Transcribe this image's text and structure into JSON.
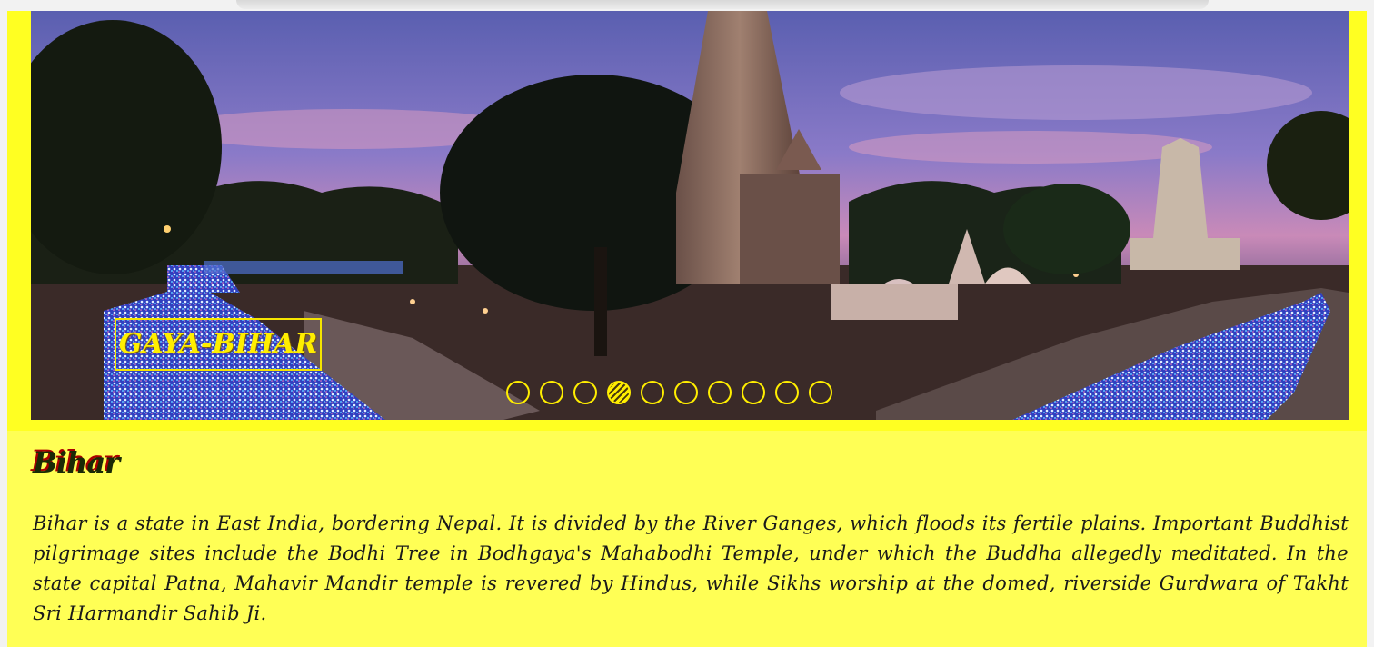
{
  "slider": {
    "caption": "GAYA-BIHAR",
    "dots": [
      {
        "label": "slide-1",
        "active": false
      },
      {
        "label": "slide-2",
        "active": false
      },
      {
        "label": "slide-3",
        "active": false
      },
      {
        "label": "slide-4",
        "active": true
      },
      {
        "label": "slide-5",
        "active": false
      },
      {
        "label": "slide-6",
        "active": false
      },
      {
        "label": "slide-7",
        "active": false
      },
      {
        "label": "slide-8",
        "active": false
      },
      {
        "label": "slide-9",
        "active": false
      },
      {
        "label": "slide-10",
        "active": false
      }
    ],
    "accent_color": "#ffee00"
  },
  "content": {
    "heading": "Bihar",
    "description": "Bihar is a state in East India, bordering Nepal. It is divided by the River Ganges, which floods its fertile plains. Important Buddhist pilgrimage sites include the Bodhi Tree in Bodhgaya's Mahabodhi Temple, under which the Buddha allegedly meditated. In the state capital Patna, Mahavir Mandir temple is revered by Hindus, while Sikhs worship at the domed, riverside Gurdwara of Takht Sri Harmandir Sahib Ji."
  },
  "colors": {
    "page_background": "#ffff55",
    "heading_shadow": "#aa0000"
  }
}
